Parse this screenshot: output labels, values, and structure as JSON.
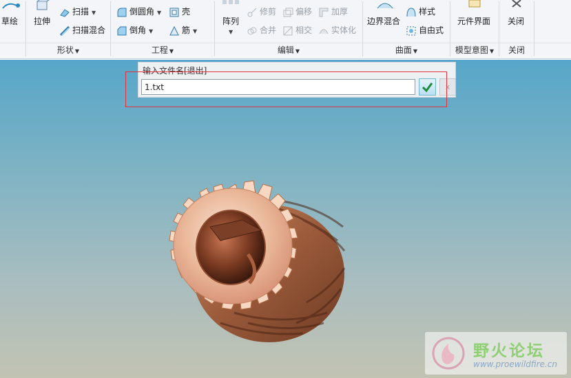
{
  "ribbon": {
    "sketch": "草绘",
    "extrude": "拉伸",
    "sweep": "扫描",
    "swept_blend": "扫描混合",
    "round": "倒圆角",
    "chamfer": "倒角",
    "shell": "壳",
    "rib": "筋",
    "pattern": "阵列",
    "trim": "修剪",
    "offset": "偏移",
    "thicken": "加厚",
    "merge": "合并",
    "intersect": "相交",
    "solidify": "实体化",
    "boundary_blend": "边界混合",
    "style": "样式",
    "freestyle": "自由式",
    "component_interface": "元件界面",
    "close": "关闭"
  },
  "groups": {
    "shapes": "形状",
    "engineering": "工程",
    "editing": "编辑",
    "surfaces": "曲面",
    "model_intent": "模型意图",
    "close": "关闭"
  },
  "dialog": {
    "title": "输入文件名[退出]",
    "value": "1.txt",
    "cancel_glyph": "x"
  },
  "watermark": {
    "title": "野火论坛",
    "url": "www.proewildfire.cn"
  },
  "colors": {
    "accent": "#6eb4d3",
    "highlight": "#e2333d",
    "gear_copper": "#b8714a"
  }
}
